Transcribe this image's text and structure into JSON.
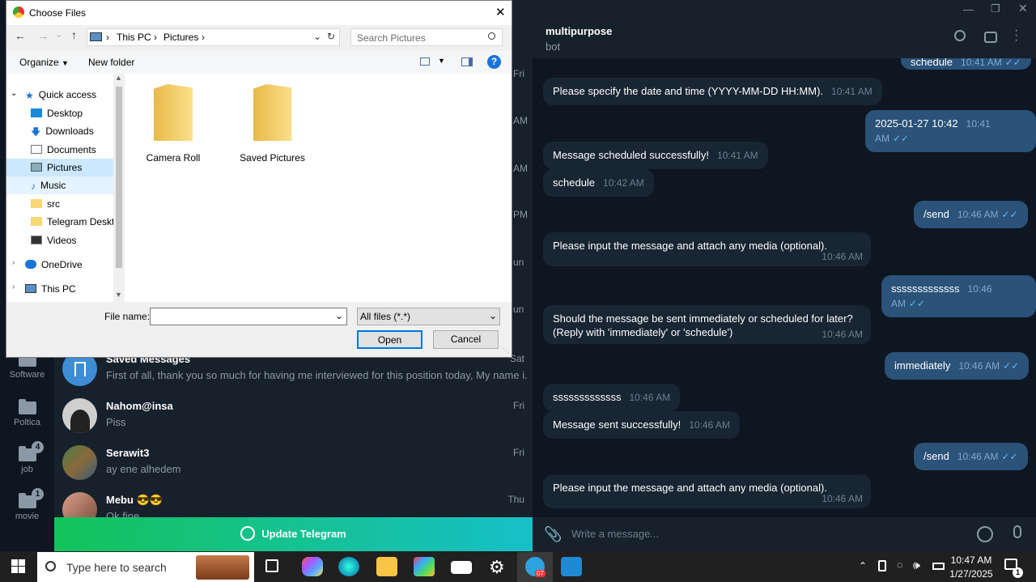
{
  "telegram": {
    "folders": [
      {
        "label": "Software",
        "badge": ""
      },
      {
        "label": "Poltica",
        "badge": ""
      },
      {
        "label": "job",
        "badge": "4"
      },
      {
        "label": "movie",
        "badge": "1"
      }
    ],
    "chats_partial_dates": [
      "Fri",
      "AM",
      "AM",
      "PM",
      "un",
      "un"
    ],
    "chats": [
      {
        "name": "Saved Messages",
        "preview": "First of all, thank you so much for having me interviewed for this position today, My name i...",
        "date": "Sat"
      },
      {
        "name": "Nahom@insa",
        "preview": "Piss",
        "date": "Fri"
      },
      {
        "name": "Serawit3",
        "preview": "ay ene alhedem",
        "date": "Fri"
      },
      {
        "name": "Mebu 😎😎",
        "preview": "Ok fine",
        "date": "Thu"
      }
    ],
    "update_label": "Update Telegram",
    "chat_title": "multipurpose",
    "chat_subtitle": "bot",
    "input_placeholder": "Write a message...",
    "messages": [
      {
        "dir": "out",
        "text": "schedule",
        "time": "10:41 AM"
      },
      {
        "dir": "in",
        "text": "Please specify the date and time (YYYY-MM-DD HH:MM).",
        "time": "10:41 AM"
      },
      {
        "dir": "out",
        "text": "2025-01-27 10:42",
        "time": "10:41 AM"
      },
      {
        "dir": "in",
        "text": "Message scheduled successfully!",
        "time": "10:41 AM"
      },
      {
        "dir": "in",
        "text": "schedule",
        "time": "10:42 AM"
      },
      {
        "dir": "out",
        "text": "/send",
        "time": "10:46 AM"
      },
      {
        "dir": "in",
        "text": "Please input the message and attach any media (optional).",
        "time": "10:46 AM"
      },
      {
        "dir": "out",
        "text": "sssssssssssss",
        "time": "10:46 AM"
      },
      {
        "dir": "in",
        "text": "Should the message be sent immediately or scheduled for later?",
        "text2": "(Reply with 'immediately' or 'schedule')",
        "time": "10:46 AM"
      },
      {
        "dir": "out",
        "text": "immediately",
        "time": "10:46 AM"
      },
      {
        "dir": "in",
        "text": "sssssssssssss",
        "time": "10:46 AM"
      },
      {
        "dir": "in",
        "text": "Message sent successfully!",
        "time": "10:46 AM"
      },
      {
        "dir": "out",
        "text": "/send",
        "time": "10:46 AM"
      },
      {
        "dir": "in",
        "text": "Please input the message and attach any media (optional).",
        "time": "10:46 AM"
      }
    ]
  },
  "dialog": {
    "title": "Choose Files",
    "path": [
      "This PC",
      "Pictures"
    ],
    "search_placeholder": "Search Pictures",
    "organize": "Organize",
    "new_folder": "New folder",
    "nav": [
      {
        "label": "Quick access"
      },
      {
        "label": "Desktop"
      },
      {
        "label": "Downloads"
      },
      {
        "label": "Documents"
      },
      {
        "label": "Pictures"
      },
      {
        "label": "Music"
      },
      {
        "label": "src"
      },
      {
        "label": "Telegram Deskto"
      },
      {
        "label": "Videos"
      },
      {
        "label": "OneDrive"
      },
      {
        "label": "This PC"
      }
    ],
    "folders": [
      "Camera Roll",
      "Saved Pictures"
    ],
    "file_name_label": "File name:",
    "file_name_value": "",
    "file_type": "All files (*.*)",
    "open": "Open",
    "cancel": "Cancel"
  },
  "taskbar": {
    "search_placeholder": "Type here to search",
    "time": "10:47 AM",
    "date": "1/27/2025",
    "notification_count": "1",
    "telegram_badge": "07"
  }
}
